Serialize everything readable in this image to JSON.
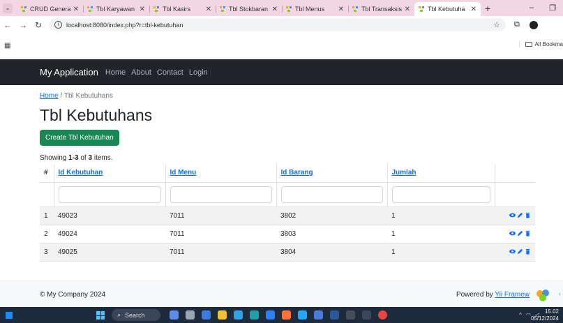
{
  "browser": {
    "tabs": [
      {
        "title": "CRUD Genera",
        "active": false
      },
      {
        "title": "Tbl Karyawan",
        "active": false
      },
      {
        "title": "Tbl Kasirs",
        "active": false
      },
      {
        "title": "Tbl Stokbaran",
        "active": false
      },
      {
        "title": "Tbl Menus",
        "active": false
      },
      {
        "title": "Tbl Transaksis",
        "active": false
      },
      {
        "title": "Tbl Kebutuha",
        "active": true
      }
    ],
    "url": "localhost:8080/index.php?r=tbl-kebutuhan",
    "bookmarks_label": "All Bookma"
  },
  "navbar": {
    "brand": "My Application",
    "links": [
      "Home",
      "About",
      "Contact",
      "Login"
    ]
  },
  "breadcrumb": {
    "home": "Home",
    "separator": "/",
    "current": "Tbl Kebutuhans"
  },
  "page": {
    "title": "Tbl Kebutuhans",
    "create_button": "Create Tbl Kebutuhan",
    "summary_prefix": "Showing ",
    "summary_range": "1-3",
    "summary_mid": " of ",
    "summary_total": "3",
    "summary_suffix": " items."
  },
  "table": {
    "headers": [
      "#",
      "Id Kebutuhan",
      "Id Menu",
      "Id Barang",
      "Jumlah"
    ],
    "rows": [
      [
        "1",
        "49023",
        "7011",
        "3802",
        "1"
      ],
      [
        "2",
        "49024",
        "7011",
        "3803",
        "1"
      ],
      [
        "3",
        "49025",
        "7011",
        "3804",
        "1"
      ]
    ]
  },
  "footer": {
    "copyright": "© My Company 2024",
    "powered_prefix": "Powered by ",
    "powered_link": "Yii Framew"
  },
  "taskbar": {
    "search": "Search",
    "time": "15.02",
    "date": "05/12/2024"
  },
  "colors": {
    "navbar_bg": "#212529",
    "primary_link": "#0d6efd",
    "create_button": "#198754"
  }
}
